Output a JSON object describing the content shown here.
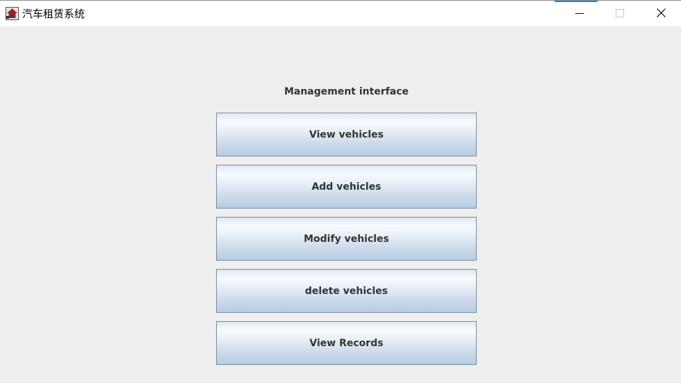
{
  "window": {
    "title": "汽车租赁系统",
    "accent_color": "#2a86d6"
  },
  "icons": {
    "app": "car-rental-app-icon",
    "minimize": "minimize-icon",
    "maximize": "maximize-icon",
    "close": "close-icon"
  },
  "main": {
    "heading": "Management interface",
    "buttons": [
      {
        "label": "View vehicles"
      },
      {
        "label": "Add vehicles"
      },
      {
        "label": "Modify vehicles"
      },
      {
        "label": "delete vehicles"
      },
      {
        "label": "View Records"
      }
    ],
    "button_gradient_colors": [
      "#dde8f3",
      "#f9fbfe",
      "#b8cce2"
    ],
    "background_color": "#eeeeee"
  }
}
